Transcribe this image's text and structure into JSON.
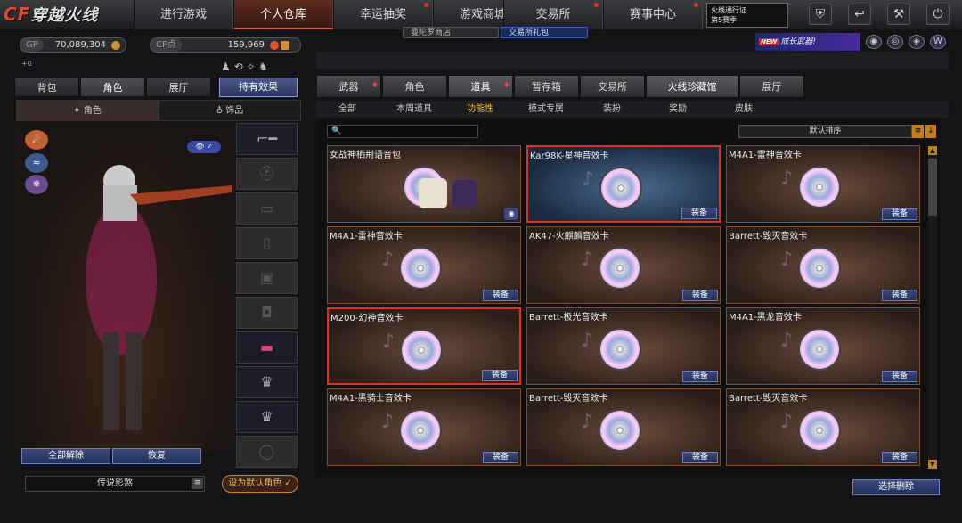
{
  "logo": {
    "cf": "CF",
    "text": "穿越火线"
  },
  "nav": [
    {
      "label": "进行游戏"
    },
    {
      "label": "个人仓库"
    },
    {
      "label": "幸运抽奖"
    },
    {
      "label": "游戏商城"
    },
    {
      "label": "交易所"
    },
    {
      "label": "赛事中心"
    }
  ],
  "subnav": {
    "shop": "曼陀罗商店",
    "gift": "交易所礼包"
  },
  "promo_top": {
    "text": "火线通行证\n第5赛季"
  },
  "top_icons": [
    "shield-icon",
    "back-icon",
    "wrench-icon",
    "power-icon"
  ],
  "promo_banner": {
    "new": "NEW",
    "text": "成长武器!"
  },
  "currency": {
    "gp_label": "GP",
    "gp_value": "70,089,304",
    "cf_label": "CF点",
    "cf_value": "159,969"
  },
  "left_tabs": [
    "背包",
    "角色",
    "展厅"
  ],
  "effect_button": "持有效果",
  "char_tabs": [
    "角色",
    "饰品"
  ],
  "buttons": {
    "unequip_all": "全部解除",
    "restore": "恢复",
    "set_default": "设为默认角色"
  },
  "character_title": "传说影煞",
  "right_tabs": [
    "武器",
    "角色",
    "道具",
    "暂存箱",
    "交易所",
    "火线珍藏馆",
    "展厅"
  ],
  "sub_tabs": [
    "全部",
    "本周道具",
    "功能性",
    "模式专属",
    "装扮",
    "奖励",
    "皮肤"
  ],
  "sort_label": "默认排序",
  "equip_label": "装备",
  "delete_button": "选择删除",
  "items": [
    {
      "name": "女战神栖荆语音包"
    },
    {
      "name": "Kar98K-星神音效卡"
    },
    {
      "name": "M4A1-雷神音效卡"
    },
    {
      "name": "M4A1-雷神音效卡"
    },
    {
      "name": "AK47-火麒麟音效卡"
    },
    {
      "name": "Barrett-毁灭音效卡"
    },
    {
      "name": "M200-幻神音效卡"
    },
    {
      "name": "Barrett-极光音效卡"
    },
    {
      "name": "M4A1-黑龙音效卡"
    },
    {
      "name": "M4A1-黑骑士音效卡"
    },
    {
      "name": "Barrett-毁灭音效卡"
    },
    {
      "name": "Barrett-毁灭音效卡"
    }
  ]
}
